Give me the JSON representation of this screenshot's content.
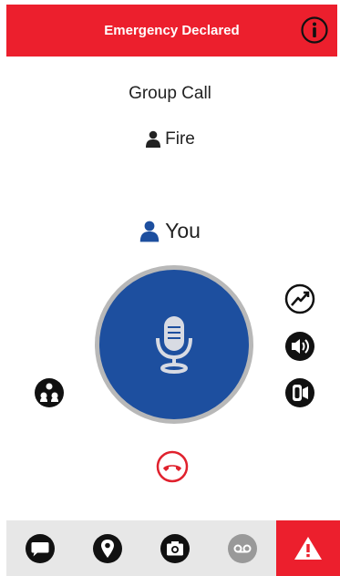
{
  "header": {
    "title": "Emergency Declared",
    "color": "#ec1f2d"
  },
  "call": {
    "type_label": "Group Call",
    "group_name": "Fire",
    "talker": "You"
  },
  "ptt": {
    "color": "#1d4f9f",
    "icon": "microphone-icon"
  },
  "side_controls": [
    {
      "name": "signal-strength-icon"
    },
    {
      "name": "speaker-icon"
    },
    {
      "name": "earpiece-icon"
    },
    {
      "name": "group-members-icon"
    },
    {
      "name": "end-call-icon",
      "color": "#e0212d"
    }
  ],
  "nav": {
    "items": [
      {
        "name": "message-icon"
      },
      {
        "name": "location-icon"
      },
      {
        "name": "camera-icon"
      },
      {
        "name": "voicemail-icon",
        "state": "disabled"
      },
      {
        "name": "emergency-alert-icon",
        "color": "#ec1f2d"
      }
    ]
  }
}
